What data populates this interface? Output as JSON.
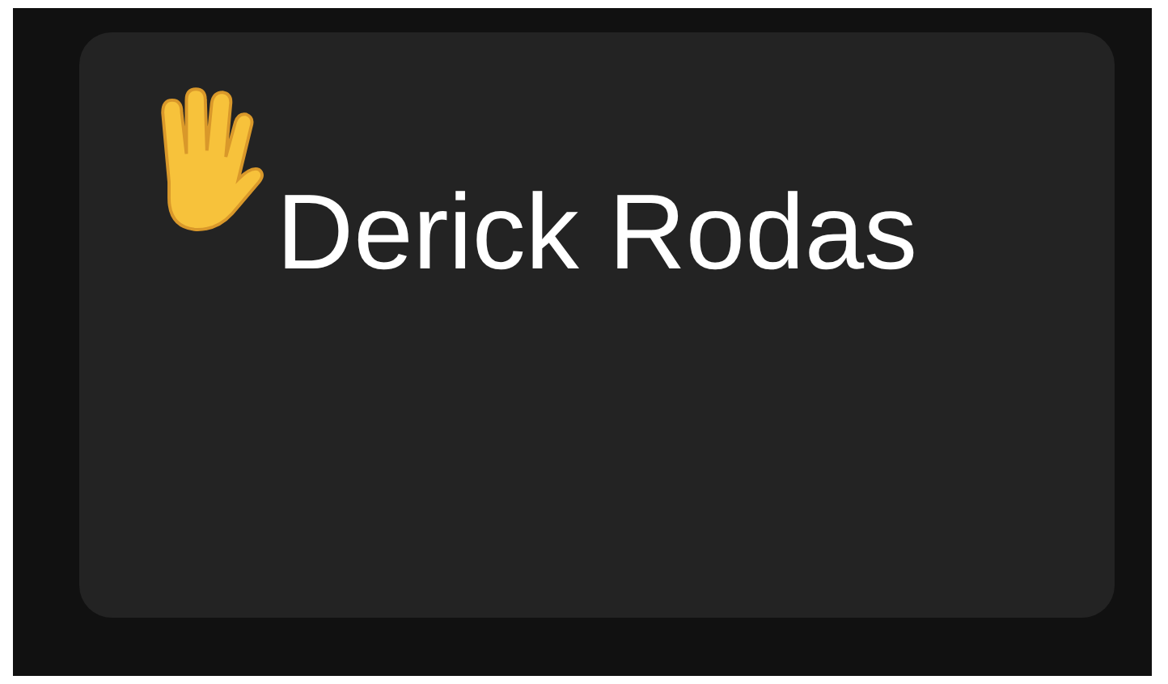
{
  "participant": {
    "name": "Derick Rodas",
    "hand_raised": true
  }
}
